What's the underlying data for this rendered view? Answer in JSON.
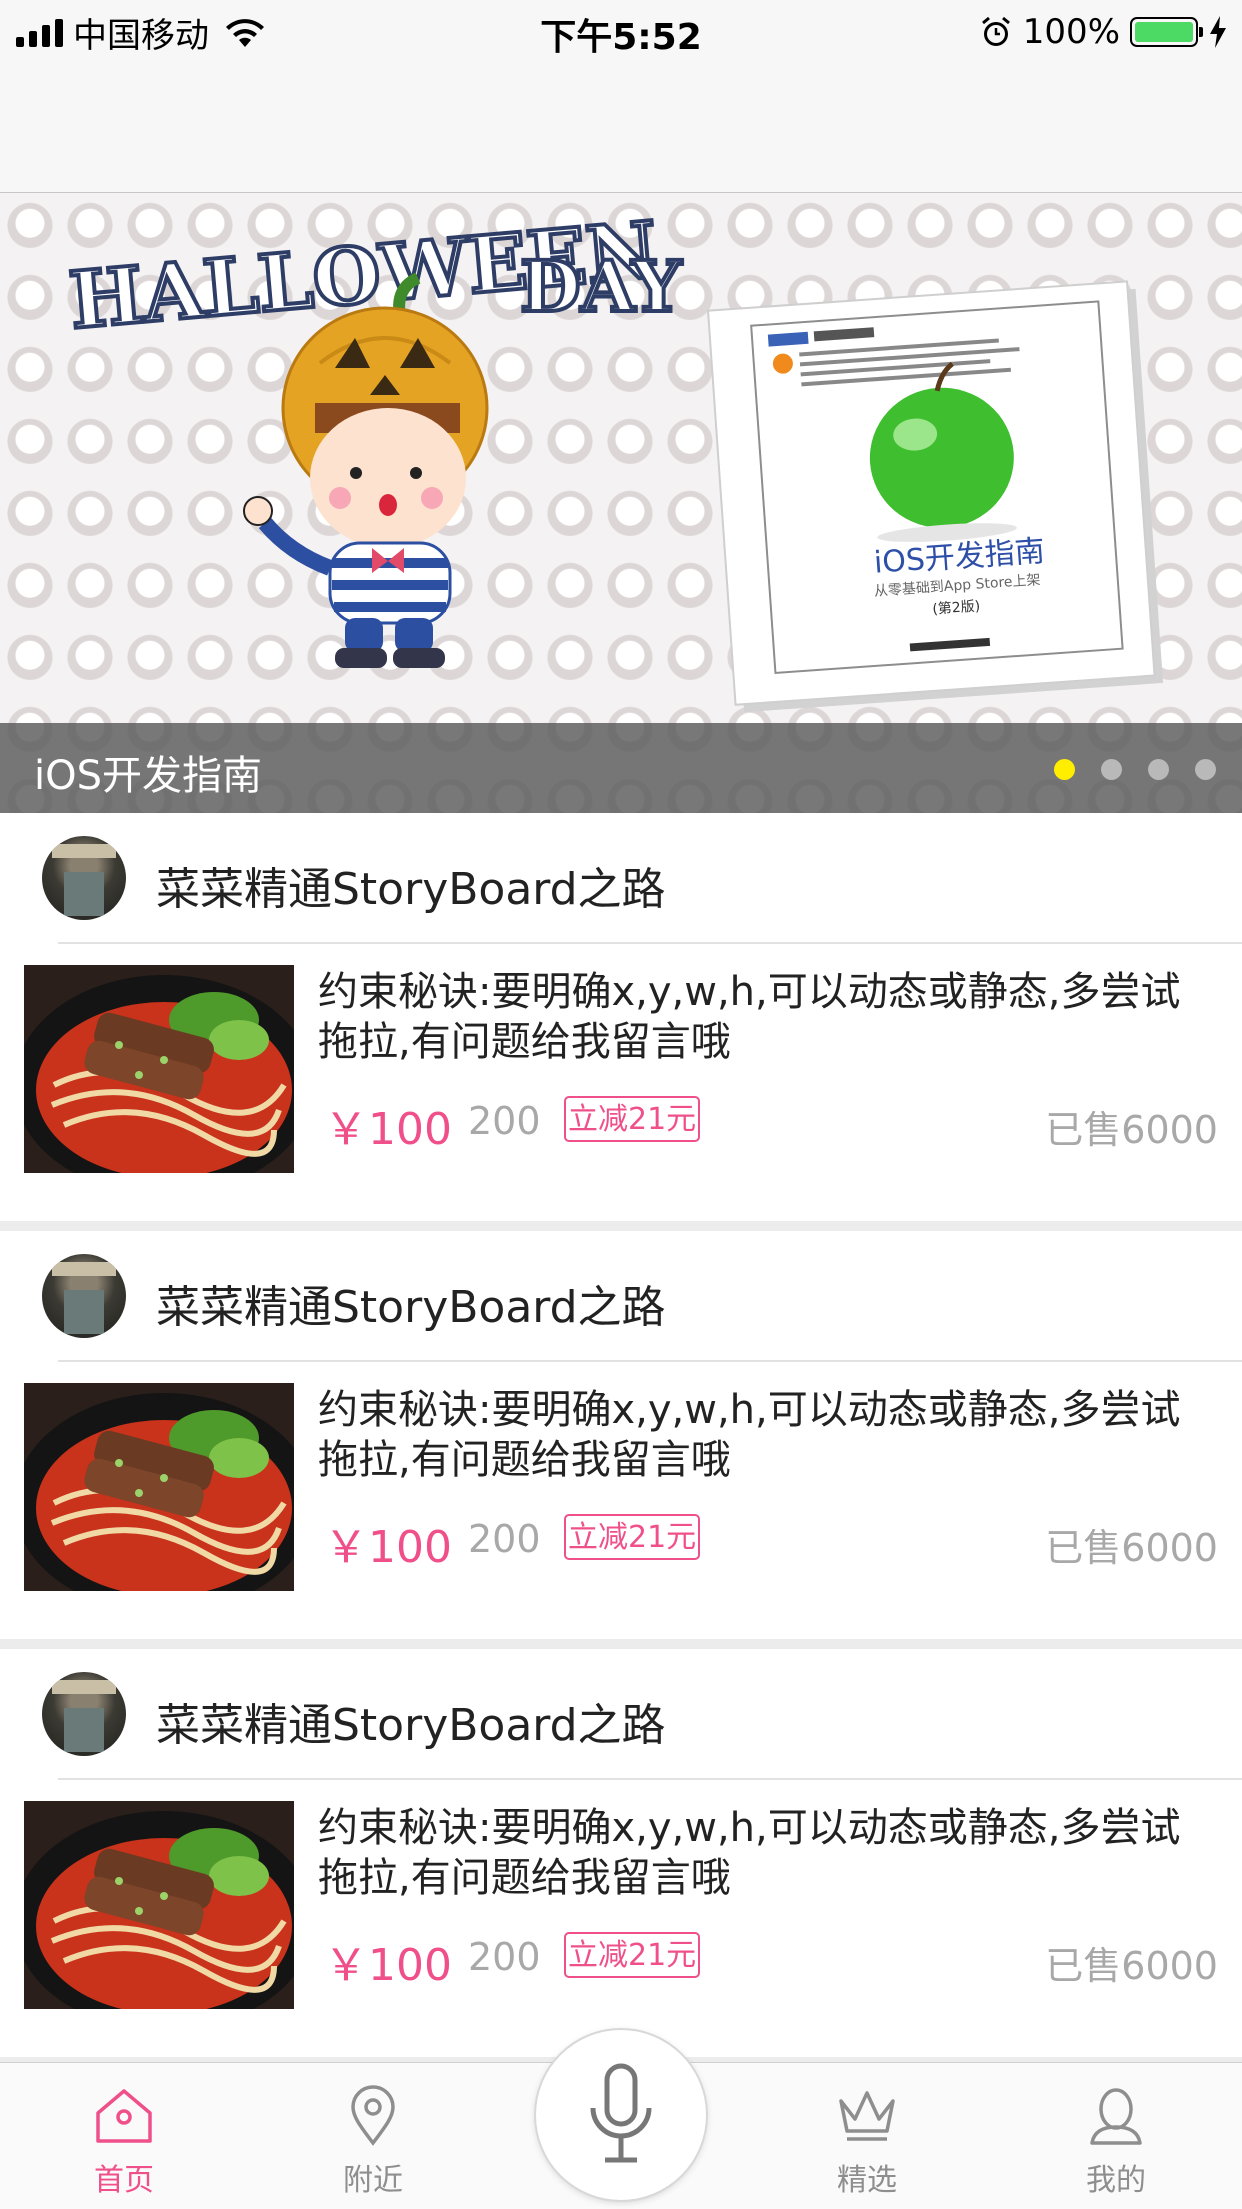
{
  "status_bar": {
    "carrier": "中国移动",
    "time": "下午5:52",
    "battery": "100%",
    "battery_level": 1.0
  },
  "banner": {
    "caption": "iOS开发指南",
    "page_count": 4,
    "active_page": 0,
    "art_text_line1": "HALLOWEEN",
    "art_text_line2": "DAY",
    "book_title": "iOS开发指南",
    "book_subtitle": "从零基础到App Store上架",
    "book_edition": "(第2版)"
  },
  "feed": {
    "items": [
      {
        "title": "菜菜精通StoryBoard之路",
        "description": "约束秘诀:要明确x,y,w,h,可以动态或静态,多尝试拖拉,有问题给我留言哦",
        "price": "￥100",
        "original_price": "200",
        "discount": "立减21元",
        "sold": "已售6000"
      },
      {
        "title": "菜菜精通StoryBoard之路",
        "description": "约束秘诀:要明确x,y,w,h,可以动态或静态,多尝试拖拉,有问题给我留言哦",
        "price": "￥100",
        "original_price": "200",
        "discount": "立减21元",
        "sold": "已售6000"
      },
      {
        "title": "菜菜精通StoryBoard之路",
        "description": "约束秘诀:要明确x,y,w,h,可以动态或静态,多尝试拖拉,有问题给我留言哦",
        "price": "￥100",
        "original_price": "200",
        "discount": "立减21元",
        "sold": "已售6000"
      }
    ]
  },
  "tab_bar": {
    "tabs": [
      {
        "label": "首页",
        "icon": "home-icon",
        "active": true
      },
      {
        "label": "附近",
        "icon": "location-pin-icon",
        "active": false
      },
      {
        "label": "精选",
        "icon": "crown-icon",
        "active": false
      },
      {
        "label": "我的",
        "icon": "user-icon",
        "active": false
      }
    ],
    "center_button_icon": "microphone-icon"
  },
  "colors": {
    "accent": "#f0508a",
    "active_dot": "#ffee00",
    "inactive_text": "#8e8e8e",
    "battery_green": "#4cd964"
  }
}
